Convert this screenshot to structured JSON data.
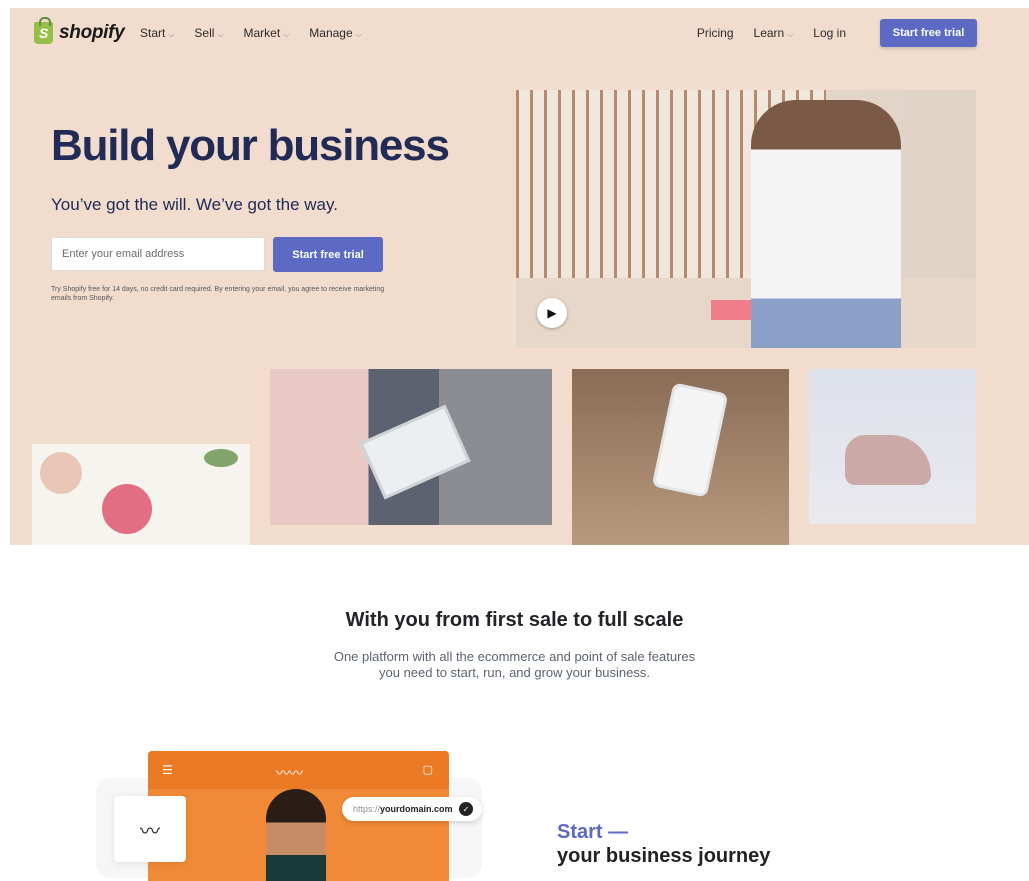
{
  "nav": {
    "logo_text": "shopify",
    "left_items": [
      {
        "label": "Start"
      },
      {
        "label": "Sell"
      },
      {
        "label": "Market"
      },
      {
        "label": "Manage"
      }
    ],
    "right_items": [
      {
        "label": "Pricing"
      },
      {
        "label": "Learn"
      },
      {
        "label": "Log in"
      }
    ],
    "cta": "Start free trial"
  },
  "hero": {
    "headline": "Build your business",
    "subheadline": "You’ve got the will. We’ve got the way.",
    "email_placeholder": "Enter your email address",
    "cta": "Start free trial",
    "legal": "Try Shopify free for 14 days, no credit card required. By entering your email, you agree to receive marketing emails from Shopify."
  },
  "section": {
    "title": "With you from first sale to full scale",
    "subtitle_line1": "One platform with all the ecommerce and point of sale features",
    "subtitle_line2": "you need to start, run, and grow your business."
  },
  "feature": {
    "url_prefix": "https://",
    "url_domain": "yourdomain.com",
    "heading_accent": "Start —",
    "heading": "your business journey"
  },
  "icons": {
    "logo": "shopping-bag-icon",
    "chevron": "chevron-down-icon",
    "play": "play-icon",
    "check": "check-circle-icon",
    "menu": "hamburger-menu-icon",
    "cart": "cart-icon"
  },
  "colors": {
    "hero_bg": "#f1dcce",
    "brand": "#5c6ac4",
    "headline": "#212b55",
    "logo_green": "#95bf47"
  }
}
